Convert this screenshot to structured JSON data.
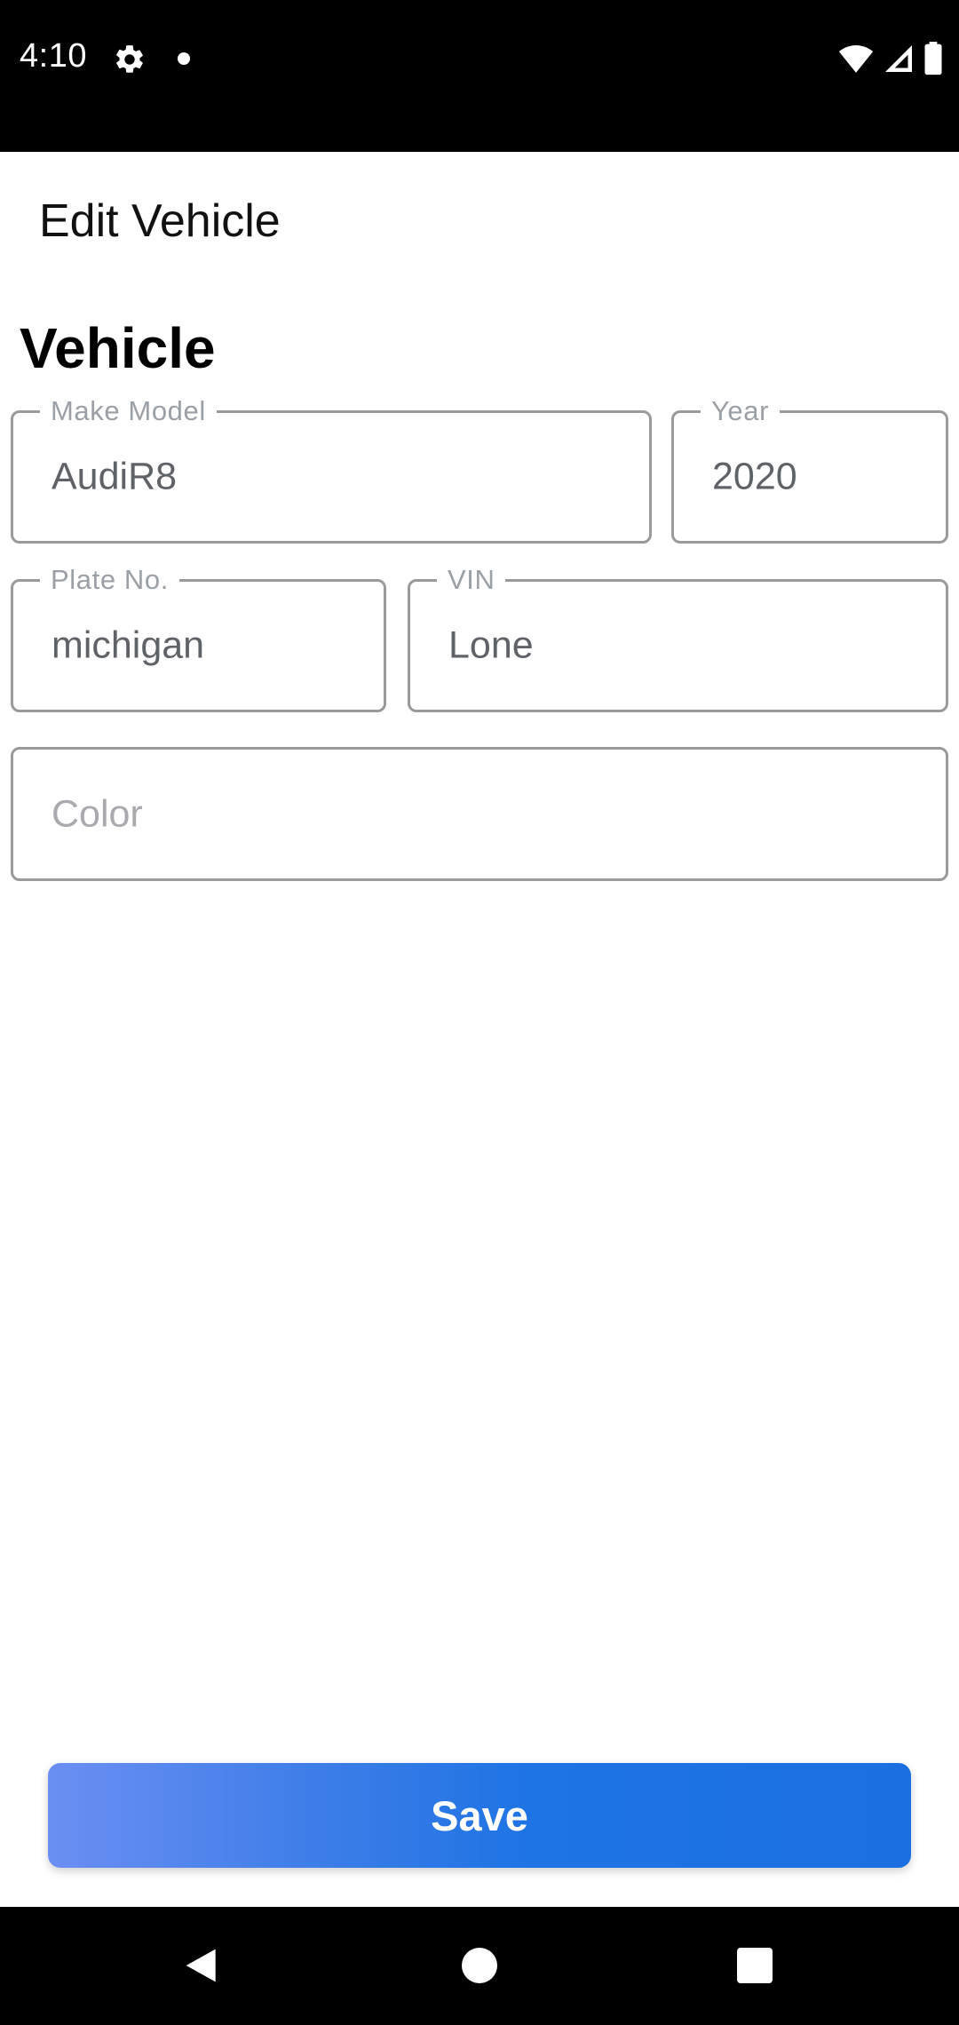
{
  "status_bar": {
    "time": "4:10",
    "icons": [
      "gear-icon",
      "notification-dot-icon",
      "wifi-icon",
      "signal-icon",
      "battery-icon"
    ]
  },
  "app_bar": {
    "title": "Edit Vehicle"
  },
  "section": {
    "title": "Vehicle"
  },
  "fields": {
    "make_model": {
      "label": "Make Model",
      "value": "AudiR8"
    },
    "year": {
      "label": "Year",
      "value": "2020"
    },
    "plate": {
      "label": "Plate No.",
      "value": "michigan"
    },
    "vin": {
      "label": "VIN",
      "value": "Lone"
    },
    "color": {
      "placeholder": "Color",
      "value": ""
    }
  },
  "actions": {
    "save_label": "Save"
  },
  "nav_bar": {
    "icons": [
      "back-icon",
      "home-icon",
      "recents-icon"
    ]
  },
  "colors": {
    "accent": "#1f74e4",
    "accent_start": "#6b8ff2",
    "field_border": "#9a9a9a",
    "label": "#9aa0a6"
  }
}
